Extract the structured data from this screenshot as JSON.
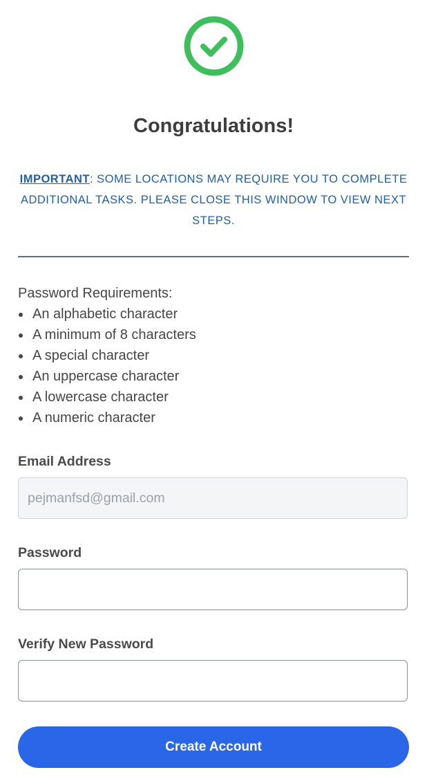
{
  "success": {
    "icon": "check-circle-icon",
    "title": "Congratulations!"
  },
  "notice": {
    "important": "IMPORTANT",
    "text": ": SOME LOCATIONS MAY REQUIRE YOU TO COMPLETE ADDITIONAL TASKS. PLEASE CLOSE THIS WINDOW TO VIEW NEXT STEPS."
  },
  "requirements": {
    "heading": "Password Requirements:",
    "items": [
      "An alphabetic character",
      "A minimum of 8 characters",
      "A special character",
      "An uppercase character",
      "A lowercase character",
      "A numeric character"
    ]
  },
  "form": {
    "email_label": "Email Address",
    "email_value": "pejmanfsd@gmail.com",
    "password_label": "Password",
    "password_value": "",
    "verify_label": "Verify New Password",
    "verify_value": "",
    "submit_label": "Create Account"
  },
  "colors": {
    "success_green": "#3fbf5c",
    "notice_blue": "#1f5fa8",
    "button_blue": "#2a66e8"
  }
}
